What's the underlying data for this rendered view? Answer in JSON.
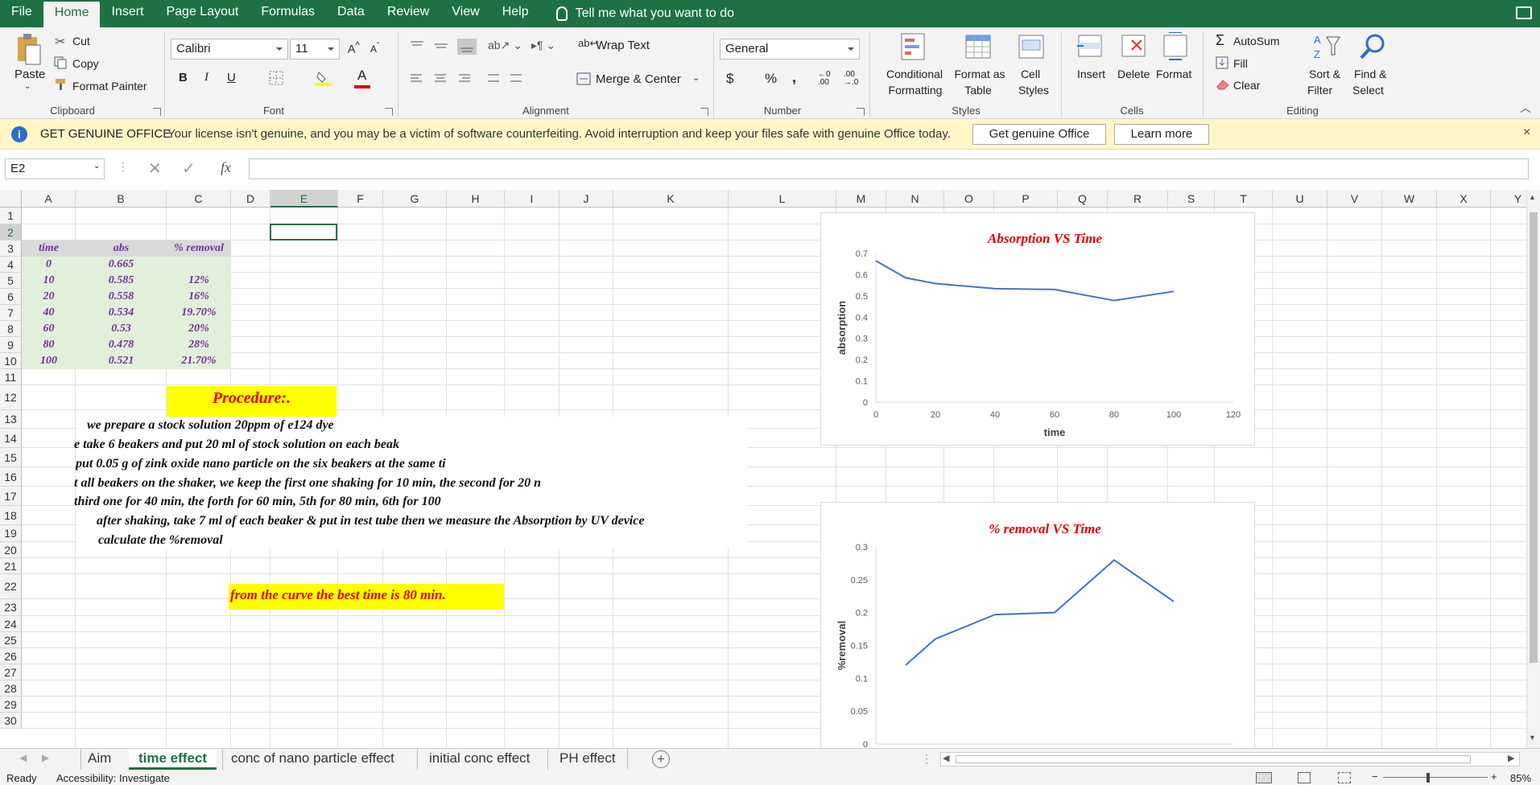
{
  "menu": {
    "tabs": [
      "File",
      "Home",
      "Insert",
      "Page Layout",
      "Formulas",
      "Data",
      "Review",
      "View",
      "Help"
    ],
    "active": "Home",
    "tell_me": "Tell me what you want to do"
  },
  "ribbon": {
    "clipboard": {
      "paste": "Paste",
      "cut": "Cut",
      "copy": "Copy",
      "format_painter": "Format Painter",
      "label": "Clipboard"
    },
    "font": {
      "name": "Calibri",
      "size": "11",
      "bold": "B",
      "italic": "I",
      "underline": "U",
      "label": "Font"
    },
    "alignment": {
      "wrap": "Wrap Text",
      "merge": "Merge & Center",
      "label": "Alignment"
    },
    "number": {
      "format": "General",
      "currency": "$",
      "percent": "%",
      "comma": ",",
      "label": "Number"
    },
    "styles": {
      "conditional": [
        "Conditional",
        "Formatting"
      ],
      "format_table": [
        "Format as",
        "Table"
      ],
      "cell_styles": [
        "Cell",
        "Styles"
      ],
      "label": "Styles"
    },
    "cells": {
      "insert": "Insert",
      "delete": "Delete",
      "format": "Format",
      "label": "Cells"
    },
    "editing": {
      "autosum": "AutoSum",
      "fill": "Fill",
      "clear": "Clear",
      "sort": [
        "Sort &",
        "Filter"
      ],
      "find": [
        "Find &",
        "Select"
      ],
      "label": "Editing"
    }
  },
  "message_bar": {
    "title": "GET GENUINE OFFICE",
    "text": "Your license isn't genuine, and you may be a victim of software counterfeiting. Avoid interruption and keep your files safe with genuine Office today.",
    "btn_get": "Get genuine Office",
    "btn_learn": "Learn more"
  },
  "formula_bar": {
    "name_box": "E2",
    "fx": "fx",
    "value": ""
  },
  "columns": [
    "A",
    "B",
    "C",
    "D",
    "E",
    "F",
    "G",
    "H",
    "I",
    "J",
    "K",
    "L",
    "M",
    "N",
    "O",
    "P",
    "Q",
    "R",
    "S",
    "T",
    "U",
    "V",
    "W",
    "X",
    "Y"
  ],
  "rows": [
    "1",
    "2",
    "3",
    "4",
    "5",
    "6",
    "7",
    "8",
    "9",
    "10",
    "11",
    "12",
    "13",
    "14",
    "15",
    "16",
    "17",
    "18",
    "19",
    "20",
    "21",
    "22",
    "23",
    "24",
    "25",
    "26",
    "27",
    "28",
    "29",
    "30"
  ],
  "table": {
    "headers": [
      "time",
      "abs",
      "% removal"
    ],
    "rows": [
      [
        "0",
        "0.665",
        ""
      ],
      [
        "10",
        "0.585",
        "12%"
      ],
      [
        "20",
        "0.558",
        "16%"
      ],
      [
        "40",
        "0.534",
        "19.70%"
      ],
      [
        "60",
        "0.53",
        "20%"
      ],
      [
        "80",
        "0.478",
        "28%"
      ],
      [
        "100",
        "0.521",
        "21.70%"
      ]
    ]
  },
  "procedure": {
    "title": "Procedure:.",
    "lines": [
      "we prepare a stock solution 20ppm of e124 dye",
      "e take 6 beakers and put 20 ml of stock solution on each beak",
      "put 0.05 g of zink oxide nano particle on the six beakers at the same ti",
      "t all beakers on the shaker, we keep the first one shaking for 10 min, the second for 20 n",
      "third one for 40 min, the forth for 60 min, 5th for 80 min, 6th for 100",
      "after shaking, take 7 ml of each beaker & put in test tube then we measure the Absorption by UV device",
      "calculate the %removal"
    ],
    "conclusion": "from the curve the best time is 80 min."
  },
  "chart_data": [
    {
      "type": "line",
      "title": "Absorption VS Time",
      "xlabel": "time",
      "ylabel": "absorption",
      "x": [
        0,
        10,
        20,
        40,
        60,
        80,
        100
      ],
      "series": [
        {
          "values": [
            0.665,
            0.585,
            0.558,
            0.534,
            0.53,
            0.478,
            0.521
          ]
        }
      ],
      "xlim": [
        0,
        120
      ],
      "ylim": [
        0,
        0.7
      ],
      "xticks": [
        "0",
        "20",
        "40",
        "60",
        "80",
        "100",
        "120"
      ],
      "yticks": [
        "0",
        "0.1",
        "0.2",
        "0.3",
        "0.4",
        "0.5",
        "0.6",
        "0.7"
      ],
      "color": "#4472c4",
      "title_color": "#e00000",
      "grid": false
    },
    {
      "type": "line",
      "title": "% removal VS Time",
      "xlabel": "",
      "ylabel": "%removal",
      "x": [
        10,
        20,
        40,
        60,
        80,
        100
      ],
      "series": [
        {
          "values": [
            0.12,
            0.16,
            0.197,
            0.2,
            0.28,
            0.217
          ]
        }
      ],
      "xlim": [
        0,
        120
      ],
      "ylim": [
        0,
        0.3
      ],
      "yticks": [
        "0",
        "0.05",
        "0.1",
        "0.15",
        "0.2",
        "0.25",
        "0.3"
      ],
      "color": "#4472c4",
      "title_color": "#e00000",
      "grid": false
    }
  ],
  "sheet_tabs": {
    "tabs": [
      "Aim",
      "time effect",
      "conc of nano particle effect",
      "initial conc effect",
      "PH effect"
    ],
    "active": "time effect"
  },
  "status": {
    "ready": "Ready",
    "accessibility": "Accessibility: Investigate",
    "zoom": "85%"
  },
  "colors": {
    "excel_green": "#1e7145",
    "table_header_bg": "#d9d9d9",
    "table_bg": "#e2efda",
    "highlight": "#ffff00",
    "purple": "#7030a0"
  }
}
